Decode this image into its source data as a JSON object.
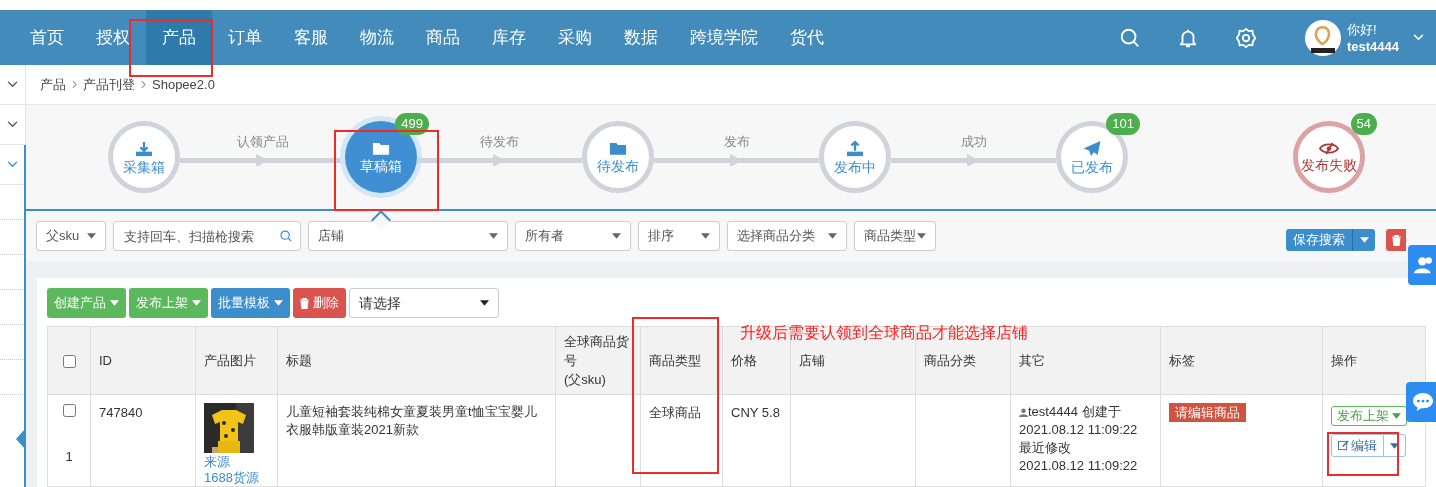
{
  "nav": {
    "items": [
      {
        "label": "首页",
        "selected": false
      },
      {
        "label": "授权",
        "selected": false
      },
      {
        "label": "产品",
        "selected": true
      },
      {
        "label": "订单",
        "selected": false
      },
      {
        "label": "客服",
        "selected": false
      },
      {
        "label": "物流",
        "selected": false
      },
      {
        "label": "商品",
        "selected": false
      },
      {
        "label": "库存",
        "selected": false
      },
      {
        "label": "采购",
        "selected": false
      },
      {
        "label": "数据",
        "selected": false
      },
      {
        "label": "跨境学院",
        "selected": false
      },
      {
        "label": "货代",
        "selected": false
      }
    ],
    "user": {
      "greeting": "你好!",
      "name": "test4444"
    }
  },
  "breadcrumb": [
    "产品",
    "产品刊登",
    "Shopee2.0"
  ],
  "steps": [
    {
      "label": "采集箱",
      "kind": "download",
      "selected": false
    },
    {
      "label": "草稿箱",
      "kind": "folder",
      "selected": true,
      "count": "499"
    },
    {
      "label": "待发布",
      "kind": "folder",
      "selected": false
    },
    {
      "label": "发布中",
      "kind": "upload",
      "selected": false
    },
    {
      "label": "已发布",
      "kind": "plane",
      "selected": false,
      "count": "101"
    },
    {
      "label": "发布失败",
      "kind": "failed",
      "selected": false,
      "count": "54"
    }
  ],
  "connectors": [
    "认领产品",
    "待发布",
    "发布",
    "成功"
  ],
  "filters": [
    {
      "kind": "select",
      "label": "父sku"
    },
    {
      "kind": "search",
      "placeholder": "支持回车、扫描枪搜索"
    },
    {
      "kind": "select",
      "label": "店铺"
    },
    {
      "kind": "select",
      "label": "所有者"
    },
    {
      "kind": "select",
      "label": "排序"
    },
    {
      "kind": "select",
      "label": "选择商品分类"
    },
    {
      "kind": "select",
      "label": "商品类型"
    }
  ],
  "save_search": "保存搜索",
  "toolbar": [
    {
      "label": "创建产品",
      "kind": "green"
    },
    {
      "label": "发布上架",
      "kind": "green"
    },
    {
      "label": "批量模板",
      "kind": "blue"
    },
    {
      "label": "删除",
      "kind": "red"
    }
  ],
  "batch_select": "请选择",
  "annotation": "升级后需要认领到全球商品才能选择店铺",
  "table": {
    "all_checked": false,
    "columns": [
      "ID",
      "产品图片",
      "标题",
      "全球商品货号\n(父sku)",
      "商品类型",
      "价格",
      "店铺",
      "商品分类",
      "其它",
      "标签",
      "操作"
    ],
    "rows": [
      {
        "checked": false,
        "index": "1",
        "id": "747840",
        "source": "来源",
        "source_link": "1688货源",
        "title": "儿童短袖套装纯棉女童夏装男童t恤宝宝婴儿衣服韩版童装2021新款",
        "type": "全球商品",
        "price": "CNY 5.8",
        "creator": "test4444",
        "created_label": "创建于",
        "created": "2021.08.12 11:09:22",
        "modified_label": "最近修改",
        "modified": "2021.08.12 11:09:22",
        "tag": "请编辑商品",
        "publish": "发布上架",
        "edit": "编辑"
      }
    ]
  }
}
